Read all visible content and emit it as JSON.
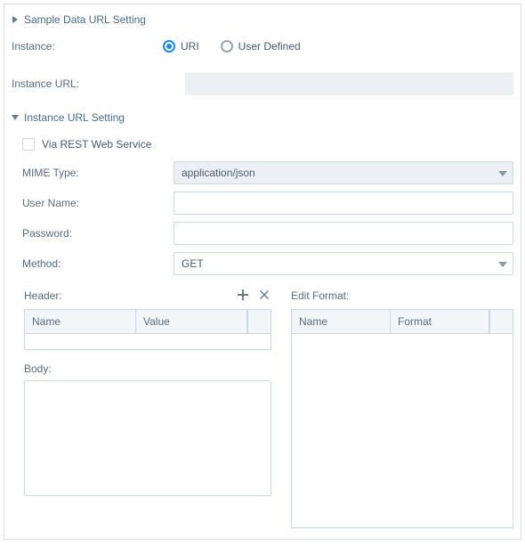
{
  "sections": {
    "sample": {
      "title": "Sample Data URL Setting"
    },
    "instance_url": {
      "title": "Instance URL Setting"
    }
  },
  "instance": {
    "label": "Instance:",
    "options": {
      "uri": "URI",
      "user_defined": "User Defined"
    },
    "selected": "uri"
  },
  "instance_url_field": {
    "label": "Instance URL:",
    "value": ""
  },
  "via_rest": {
    "label": "Via REST Web Service",
    "checked": false
  },
  "mime": {
    "label": "MIME Type:",
    "value": "application/json"
  },
  "user": {
    "label": "User Name:",
    "value": ""
  },
  "password": {
    "label": "Password:",
    "value": ""
  },
  "method": {
    "label": "Method:",
    "value": "GET"
  },
  "header_section": {
    "label": "Header:",
    "columns": {
      "name": "Name",
      "value": "Value"
    },
    "rows": []
  },
  "body_section": {
    "label": "Body:",
    "value": ""
  },
  "edit_format_section": {
    "label": "Edit Format:",
    "columns": {
      "name": "Name",
      "format": "Format"
    },
    "rows": []
  }
}
